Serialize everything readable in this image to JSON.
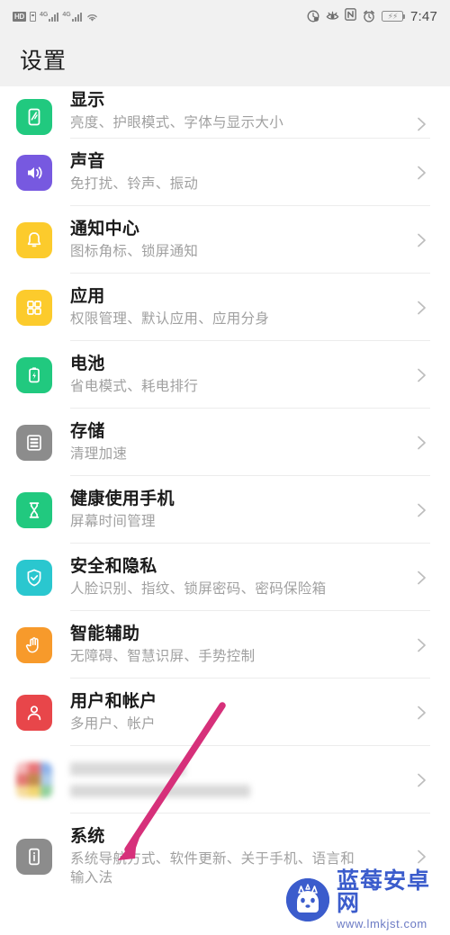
{
  "status_bar": {
    "hd_label": "HD",
    "network_label_1": "4G",
    "network_label_2": "4G",
    "time": "7:47",
    "icons": [
      "hd-icon",
      "sim-card-icon",
      "signal-4g-icon-1",
      "signal-4g-icon-2",
      "wifi-icon",
      "do-not-disturb-icon",
      "eye-comfort-icon",
      "nfc-icon",
      "alarm-icon",
      "battery-icon"
    ]
  },
  "header": {
    "title": "设置"
  },
  "list": {
    "items": [
      {
        "id": "display",
        "title": "显示",
        "subtitle": "亮度、护眼模式、字体与显示大小",
        "icon": "display-icon",
        "icon_color": "#21c97f"
      },
      {
        "id": "sound",
        "title": "声音",
        "subtitle": "免打扰、铃声、振动",
        "icon": "sound-icon",
        "icon_color": "#7759e0"
      },
      {
        "id": "notifications",
        "title": "通知中心",
        "subtitle": "图标角标、锁屏通知",
        "icon": "bell-icon",
        "icon_color": "#fccb2c"
      },
      {
        "id": "apps",
        "title": "应用",
        "subtitle": "权限管理、默认应用、应用分身",
        "icon": "apps-grid-icon",
        "icon_color": "#fccb2c"
      },
      {
        "id": "battery",
        "title": "电池",
        "subtitle": "省电模式、耗电排行",
        "icon": "battery-icon",
        "icon_color": "#21c97f"
      },
      {
        "id": "storage",
        "title": "存储",
        "subtitle": "清理加速",
        "icon": "storage-icon",
        "icon_color": "#8c8c8c"
      },
      {
        "id": "digital-balance",
        "title": "健康使用手机",
        "subtitle": "屏幕时间管理",
        "icon": "hourglass-icon",
        "icon_color": "#21c97f"
      },
      {
        "id": "security-privacy",
        "title": "安全和隐私",
        "subtitle": "人脸识别、指纹、锁屏密码、密码保险箱",
        "icon": "shield-check-icon",
        "icon_color": "#2ac7cf"
      },
      {
        "id": "smart-assistance",
        "title": "智能辅助",
        "subtitle": "无障碍、智慧识屏、手势控制",
        "icon": "hand-icon",
        "icon_color": "#f79a2b"
      },
      {
        "id": "users-accounts",
        "title": "用户和帐户",
        "subtitle": "多用户、帐户",
        "icon": "user-icon",
        "icon_color": "#e8464a"
      },
      {
        "id": "redacted",
        "title": "",
        "subtitle": "",
        "icon": "blurred-app-icon",
        "icon_color": "#cccccc",
        "redacted": true
      },
      {
        "id": "system",
        "title": "系统",
        "subtitle": "系统导航方式、软件更新、关于手机、语言和\n输入法",
        "subtitle_line1": "系统导航方式、软件更新、关于手机、语言和",
        "subtitle_line2": "输入法",
        "icon": "system-info-icon",
        "icon_color": "#8c8c8c"
      }
    ],
    "chevron_icon": "chevron-right-icon"
  },
  "annotation": {
    "arrow_icon": "pink-arrow-annotation",
    "color": "#d6307a"
  },
  "watermark": {
    "site_name": "蓝莓安卓网",
    "url": "www.lmkjst.com",
    "logo_icon": "android-mascot-logo",
    "brand_color": "#3b5ccc"
  }
}
